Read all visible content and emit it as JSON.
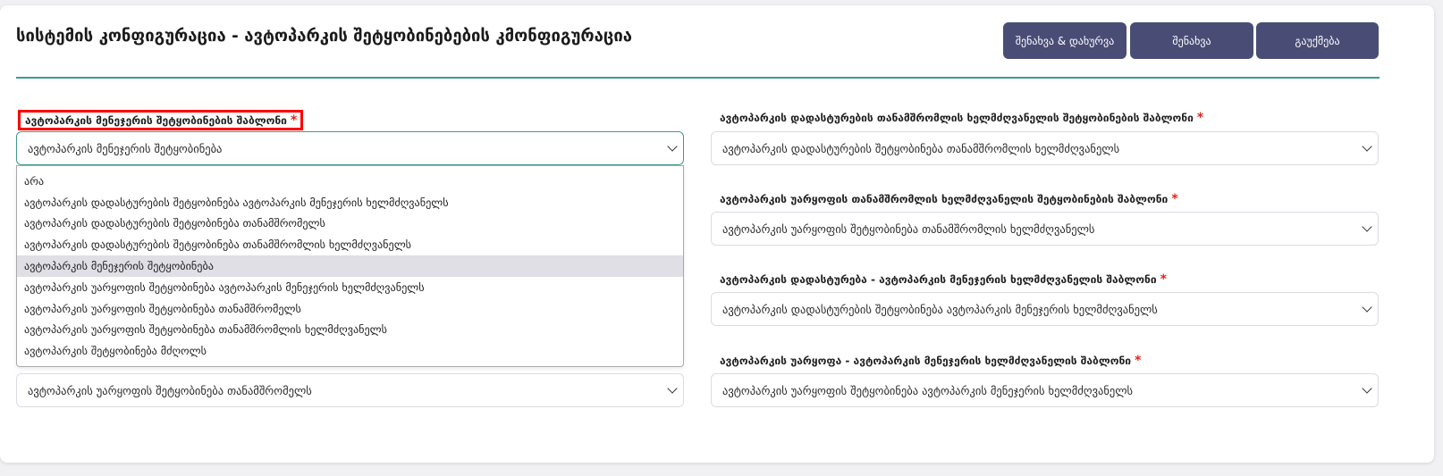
{
  "header": {
    "title": "სისტემის კონფიგურაცია - ავტოპარკის შეტყობინებების კმონფიგურაცია",
    "buttons": {
      "save_close": "შენახვა & დახურვა",
      "save": "შენახვა",
      "cancel": "გაუქმება"
    }
  },
  "left_field": {
    "label": "ავტოპარკის მენეჯერის შეტყობინების შაბლონი",
    "required_mark": "*",
    "value": "ავტოპარკის მენეჯერის შეტყობინება",
    "options": [
      "არა",
      "ავტოპარკის დადასტურების შეტყობინება ავტოპარკის მენეჯერის ხელმძღვანელს",
      "ავტოპარკის დადასტურების შეტყობინება თანამშრომელს",
      "ავტოპარკის დადასტურების შეტყობინება თანამშრომლის ხელმძღვანელს",
      "ავტოპარკის მენეჯერის შეტყობინება",
      "ავტოპარკის უარყოფის შეტყობინება ავტოპარკის მენეჯერის ხელმძღვანელს",
      "ავტოპარკის უარყოფის შეტყობინება თანამშრომელს",
      "ავტოპარკის უარყოფის შეტყობინება თანამშრომლის ხელმძღვანელს",
      "ავტოპარკის შეტყობინება მძღოლს"
    ],
    "selected_index": 4
  },
  "left_bottom_field": {
    "value": "ავტოპარკის უარყოფის შეტყობინება თანამშრომელს"
  },
  "right_fields": [
    {
      "label": "ავტოპარკის დადასტურების თანამშრომლის ხელმძღვანელის შეტყობინების შაბლონი",
      "value": "ავტოპარკის დადასტურების შეტყობინება თანამშრომლის ხელმძღვანელს"
    },
    {
      "label": "ავტოპარკის უარყოფის თანამშრომლის ხელმძღვანელის შეტყობინების შაბლონი",
      "value": "ავტოპარკის უარყოფის შეტყობინება თანამშრომლის ხელმძღვანელს"
    },
    {
      "label": "ავტოპარკის დადასტურება - ავტოპარკის მენეჯერის ხელმძღვანელის შაბლონი",
      "value": "ავტოპარკის დადასტურების შეტყობინება ავტოპარკის მენეჯერის ხელმძღვანელს"
    },
    {
      "label": "ავტოპარკის უარყოფა - ავტოპარკის მენეჯერის ხელმძღვანელის შაბლონი",
      "value": "ავტოპარკის უარყოფის შეტყობინება ავტოპარკის მენეჯერის ხელმძღვანელს"
    }
  ],
  "colors": {
    "button_bg": "#494d76",
    "divider": "#3f9a8f",
    "required": "#e0241b",
    "highlight_box": "#ff0000",
    "selected_option_bg": "#dfdfe5"
  }
}
